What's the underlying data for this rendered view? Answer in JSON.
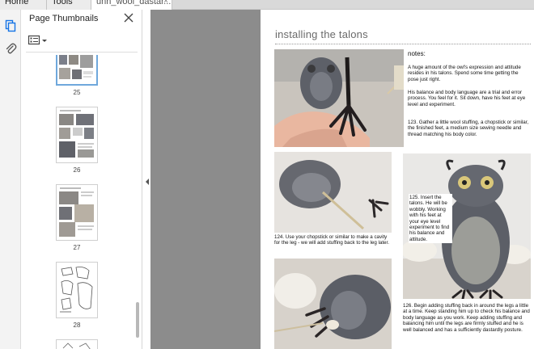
{
  "tabs": {
    "home": "Home",
    "tools": "Tools",
    "document": "unh_wool_dastar...",
    "close_glyph": "×"
  },
  "side_panel": {
    "title": "Page Thumbnails",
    "options_icon": "thumbnail-options-icon",
    "close_icon": "close-icon",
    "thumbnails": [
      {
        "label": "25",
        "selected": true
      },
      {
        "label": "26",
        "selected": false
      },
      {
        "label": "27",
        "selected": false
      },
      {
        "label": "28",
        "selected": false
      }
    ]
  },
  "rail": {
    "icons": [
      "page-thumbnails-icon",
      "attachments-icon"
    ],
    "accent": "#1473e6"
  },
  "document_page": {
    "title": "installing the talons",
    "notes_label": "notes:",
    "note_1": "A huge amount of the owl's expression and attitude resides in his talons. Spend some time getting the pose just right.",
    "note_2": "His balance and body language are a trial and error process. You feel for it.  Sit down, have his feet at eye level and experiment.",
    "step_123": "123. Gather a little wool stuffing, a chopstick or similar, the finished feet, a medium size sewing needle and thread matching his body color.",
    "step_124": "124. Use your chopstick or similar to make a cavity for the leg - we will add stuffing back to the leg later.",
    "step_125": "125. Insert the talons. He will be wobbly. Working with his feet at your eye level experiment to find his balance and attitude.",
    "step_126": "126. Begin adding stuffing back in around the legs a little at a time. Keep standing him up to check his balance and body language as you work. Keep adding stuffing and balancing him until the legs are firmly stuffed and he is well balanced and has a sufficiently dastardly posture."
  },
  "colors": {
    "viewer_bg": "#8c8c8c",
    "selected_thumb": "#6fa8dc"
  }
}
